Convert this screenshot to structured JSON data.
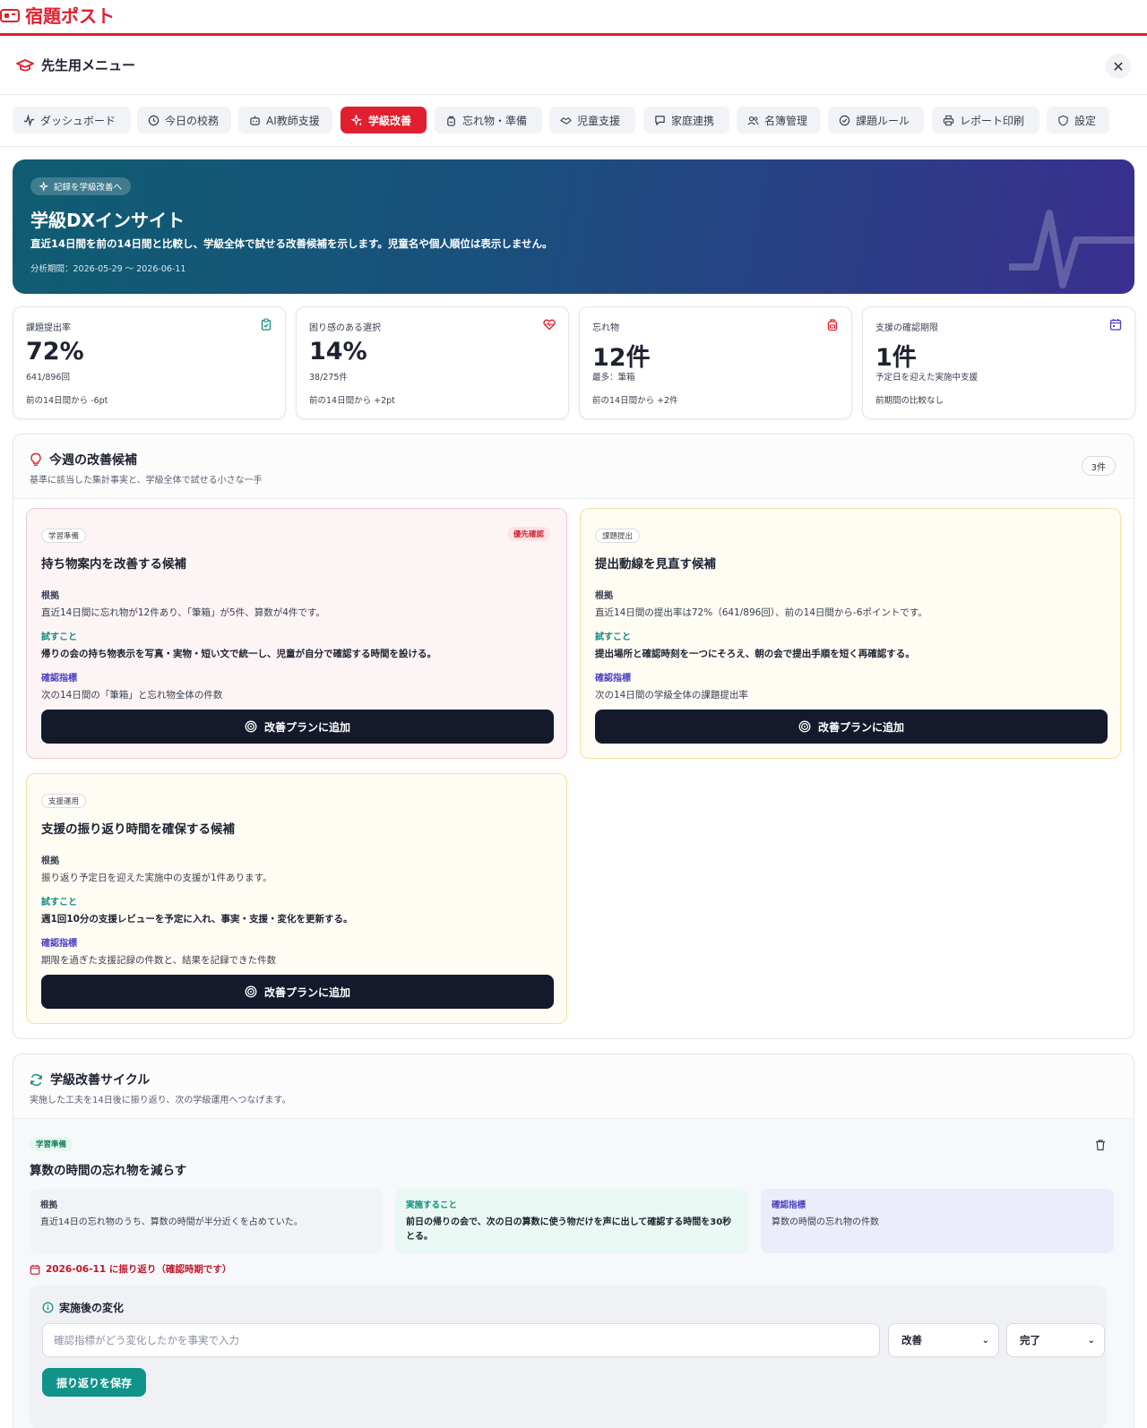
{
  "app": {
    "brand": "宿題ポスト"
  },
  "menu": {
    "title": "先生用メニュー"
  },
  "tabs": [
    {
      "label": "ダッシュボード",
      "icon": "activity-icon",
      "active": false
    },
    {
      "label": "今日の校務",
      "icon": "clock-icon",
      "active": false
    },
    {
      "label": "AI教師支援",
      "icon": "bot-icon",
      "active": false
    },
    {
      "label": "学級改善",
      "icon": "sparkle-icon",
      "active": true
    },
    {
      "label": "忘れ物・準備",
      "icon": "backpack-icon",
      "active": false
    },
    {
      "label": "児童支援",
      "icon": "handshake-icon",
      "active": false
    },
    {
      "label": "家庭連携",
      "icon": "message-icon",
      "active": false
    },
    {
      "label": "名簿管理",
      "icon": "users-icon",
      "active": false
    },
    {
      "label": "課題ルール",
      "icon": "check-circle-icon",
      "active": false
    },
    {
      "label": "レポート印刷",
      "icon": "printer-icon",
      "active": false
    },
    {
      "label": "設定",
      "icon": "shield-icon",
      "active": false
    }
  ],
  "hero": {
    "chip": "記録を学級改善へ",
    "title": "学級DXインサイト",
    "description": "直近14日間を前の14日間と比較し、学級全体で試せる改善候補を示します。児童名や個人順位は表示しません。",
    "period": "分析期間：2026-05-29 〜 2026-06-11"
  },
  "kpis": [
    {
      "label": "課題提出率",
      "value": "72%",
      "sub": "641/896回",
      "trend": "前の14日間から -6pt",
      "icon": "clipboard-check-icon",
      "color": "#0e8c7f"
    },
    {
      "label": "困り感のある選択",
      "value": "14%",
      "sub": "38/275件",
      "trend": "前の14日間から +2pt",
      "icon": "heart-pulse-icon",
      "color": "#e0202e"
    },
    {
      "label": "忘れ物",
      "value": "12件",
      "sub": "最多：筆箱",
      "trend": "前の14日間から +2件",
      "icon": "backpack-icon",
      "color": "#e0202e"
    },
    {
      "label": "支援の確認期限",
      "value": "1件",
      "sub": "予定日を迎えた実施中支援",
      "trend": "前期間の比較なし",
      "icon": "calendar-icon",
      "color": "#4a3fbf"
    }
  ],
  "improvements": {
    "title": "今週の改善候補",
    "subtitle": "基準に該当した集計事実と、学級全体で試せる小さな一手",
    "count": "3件",
    "labels": {
      "basis": "根拠",
      "try": "試すこと",
      "metric": "確認指標",
      "add_button": "改善プランに追加"
    },
    "cards": [
      {
        "tag": "学習準備",
        "priority": "優先確認",
        "title": "持ち物案内を改善する候補",
        "basis": "直近14日間に忘れ物が12件あり、「筆箱」が5件、算数が4件です。",
        "try": "帰りの会の持ち物表示を写真・実物・短い文で統一し、児童が自分で確認する時間を設ける。",
        "metric": "次の14日間の「筆箱」と忘れ物全体の件数"
      },
      {
        "tag": "課題提出",
        "priority": "",
        "title": "提出動線を見直す候補",
        "basis": "直近14日間の提出率は72%（641/896回）、前の14日間から-6ポイントです。",
        "try": "提出場所と確認時刻を一つにそろえ、朝の会で提出手順を短く再確認する。",
        "metric": "次の14日間の学級全体の課題提出率"
      },
      {
        "tag": "支援運用",
        "priority": "",
        "title": "支援の振り返り時間を確保する候補",
        "basis": "振り返り予定日を迎えた実施中の支援が1件あります。",
        "try": "週1回10分の支援レビューを予定に入れ、事実・支援・変化を更新する。",
        "metric": "期限を過ぎた支援記録の件数と、結果を記録できた件数"
      }
    ]
  },
  "cycle": {
    "title": "学級改善サイクル",
    "subtitle": "実施した工夫を14日後に振り返り、次の学級運用へつなげます。",
    "item": {
      "tag": "学習準備",
      "title": "算数の時間の忘れ物を減らす",
      "basis_label": "根拠",
      "basis": "直近14日の忘れ物のうち、算数の時間が半分近くを占めていた。",
      "action_label": "実施すること",
      "action": "前日の帰りの会で、次の日の算数に使う物だけを声に出して確認する時間を30秒とる。",
      "metric_label": "確認指標",
      "metric": "算数の時間の忘れ物の件数",
      "due": "2026-06-11 に振り返り（確認時期です）"
    },
    "after": {
      "title": "実施後の変化",
      "placeholder": "確認指標がどう変化したかを事実で入力",
      "value": "",
      "result_select": "改善",
      "status_select": "完了",
      "save_label": "振り返りを保存"
    }
  },
  "colors": {
    "accent": "#e0202e",
    "teal": "#10948a",
    "navy": "#141a2b",
    "indigo": "#4a3fbf"
  }
}
